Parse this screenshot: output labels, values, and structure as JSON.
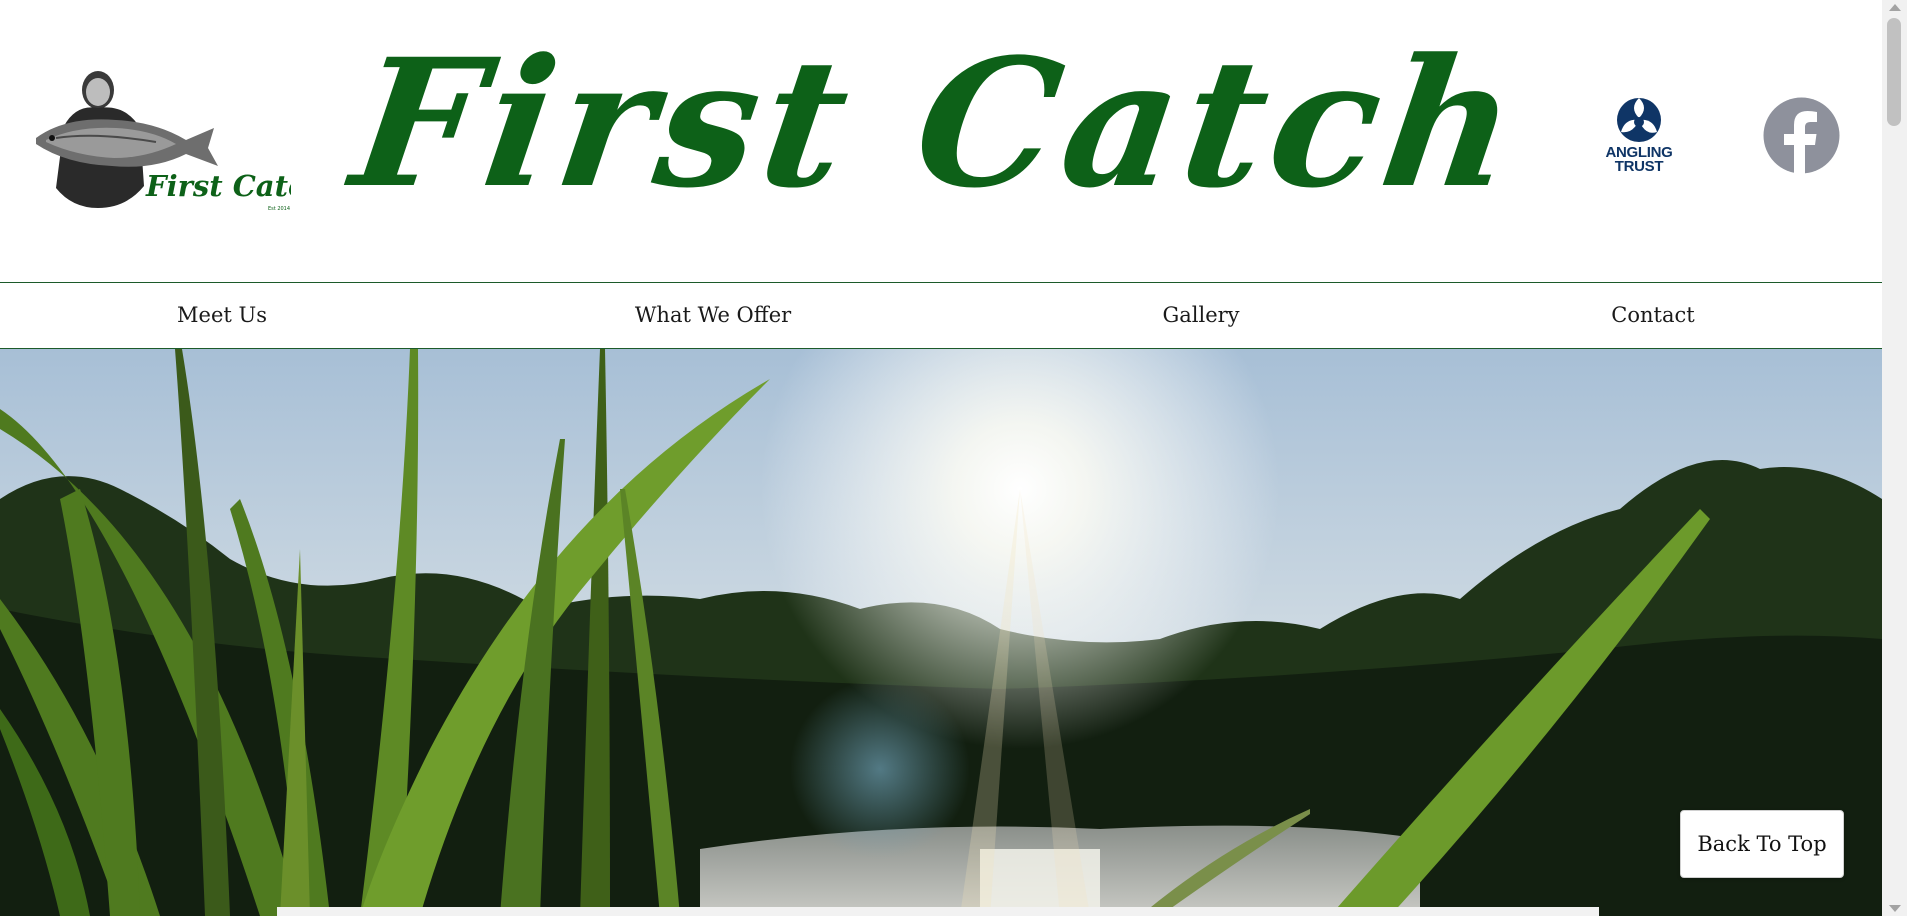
{
  "header": {
    "title": "First Catch",
    "logo_text": "First Catch",
    "logo_subtext": "Est 2014",
    "angling_trust_line1": "ANGLING",
    "angling_trust_line2": "TRUST",
    "facebook_icon": "facebook-icon"
  },
  "nav": {
    "items": [
      {
        "label": "Meet Us"
      },
      {
        "label": "What We Offer"
      },
      {
        "label": "Gallery"
      },
      {
        "label": "Contact"
      }
    ]
  },
  "back_to_top": "Back To Top",
  "colors": {
    "brand_green": "#0d6118",
    "nav_border": "#1c5a2a",
    "angling_blue": "#0f3566",
    "facebook_grey": "#8e919c"
  }
}
